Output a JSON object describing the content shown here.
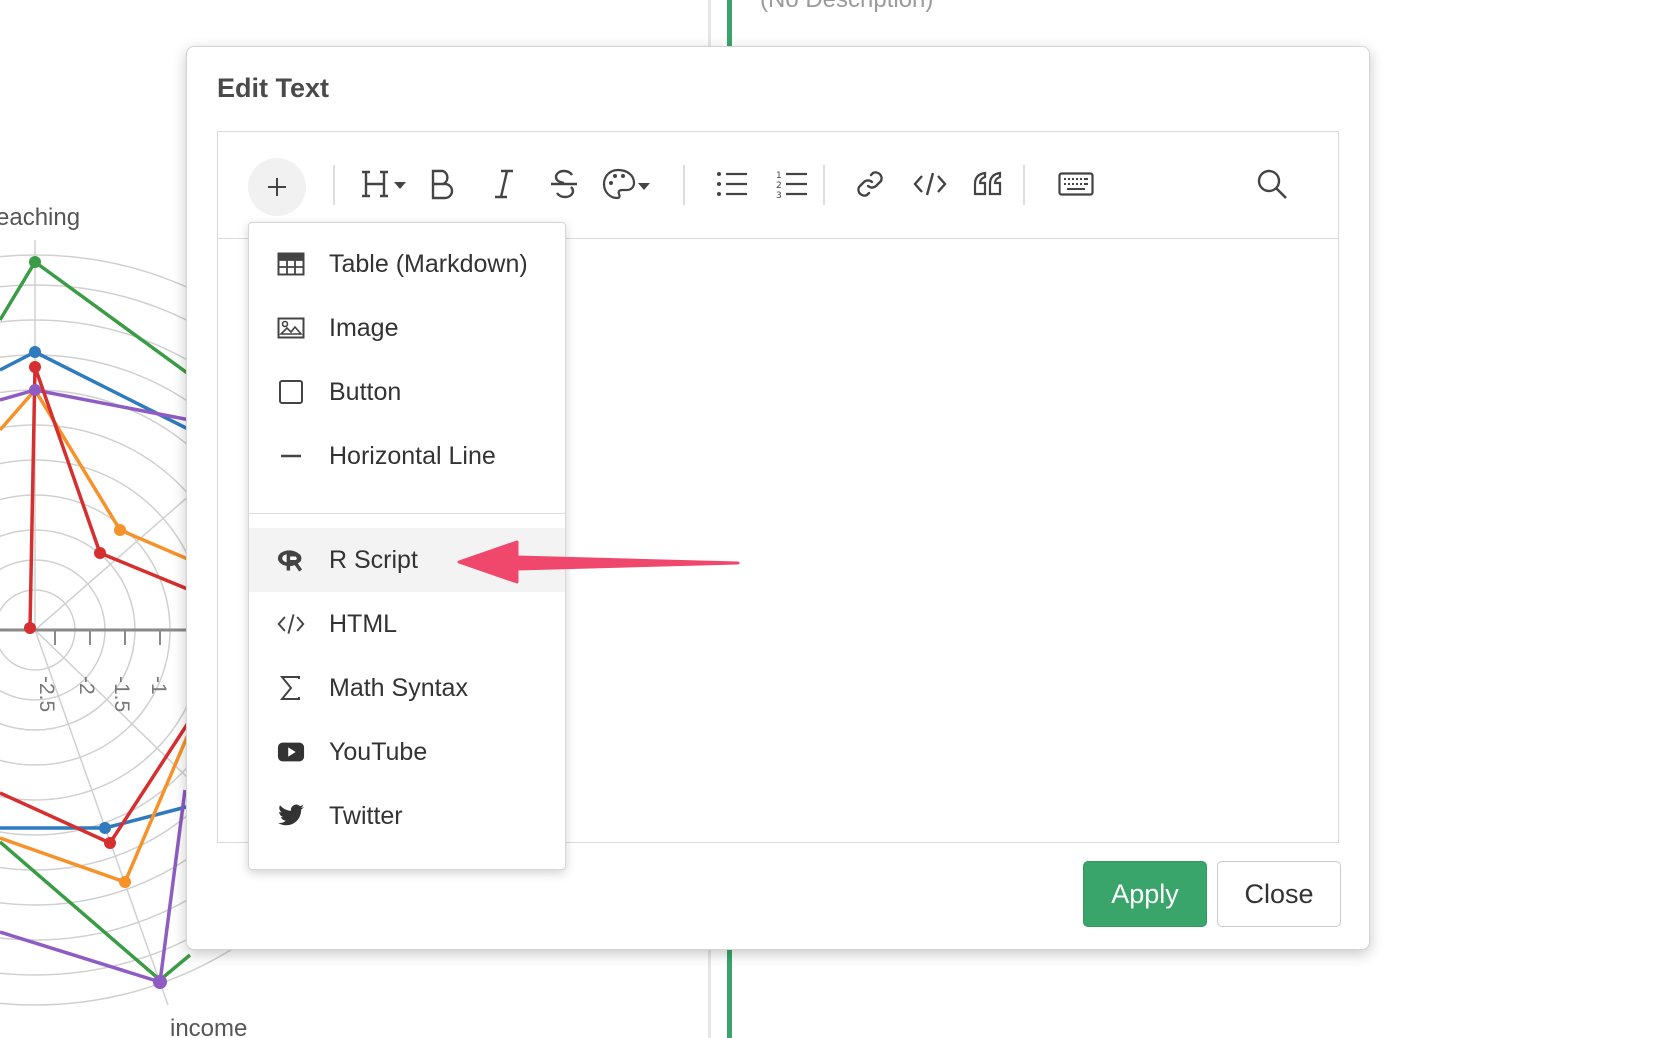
{
  "background": {
    "description_text": "(No Description)",
    "divider_color": "#3aa56b",
    "radar": {
      "axis_labels": [
        "eaching",
        "income"
      ],
      "tick_labels": [
        "-2.5",
        "-2",
        "-1.5",
        "-1"
      ],
      "series_colors": [
        "#3a9c45",
        "#2f7bbd",
        "#d62f2f",
        "#f7922a",
        "#8e5cc2"
      ]
    }
  },
  "modal": {
    "title": "Edit Text",
    "toolbar": {
      "items": [
        {
          "name": "insert-menu",
          "icon": "plus-icon"
        },
        {
          "name": "heading",
          "icon": "heading-icon"
        },
        {
          "name": "bold",
          "icon": "bold-icon"
        },
        {
          "name": "italic",
          "icon": "italic-icon"
        },
        {
          "name": "strikethrough",
          "icon": "strikethrough-icon"
        },
        {
          "name": "color",
          "icon": "palette-icon"
        },
        {
          "name": "bullet-list",
          "icon": "bullet-list-icon"
        },
        {
          "name": "numbered-list",
          "icon": "numbered-list-icon"
        },
        {
          "name": "link",
          "icon": "link-icon"
        },
        {
          "name": "code",
          "icon": "code-icon"
        },
        {
          "name": "quote",
          "icon": "quote-icon"
        },
        {
          "name": "keyboard",
          "icon": "keyboard-icon"
        },
        {
          "name": "search",
          "icon": "search-icon"
        }
      ]
    },
    "insert_menu": {
      "items": [
        {
          "label": "Table (Markdown)",
          "icon": "table-icon"
        },
        {
          "label": "Image",
          "icon": "image-icon"
        },
        {
          "label": "Button",
          "icon": "button-square-icon"
        },
        {
          "label": "Horizontal Line",
          "icon": "horizontal-line-icon"
        },
        {
          "label": "R Script",
          "icon": "r-logo-icon",
          "highlighted": true
        },
        {
          "label": "HTML",
          "icon": "code-icon"
        },
        {
          "label": "Math Syntax",
          "icon": "sigma-icon"
        },
        {
          "label": "YouTube",
          "icon": "youtube-icon"
        },
        {
          "label": "Twitter",
          "icon": "twitter-icon"
        }
      ]
    },
    "buttons": {
      "apply": "Apply",
      "close": "Close"
    },
    "colors": {
      "apply_bg": "#3aa56b",
      "annotation_arrow": "#f0476c"
    }
  }
}
